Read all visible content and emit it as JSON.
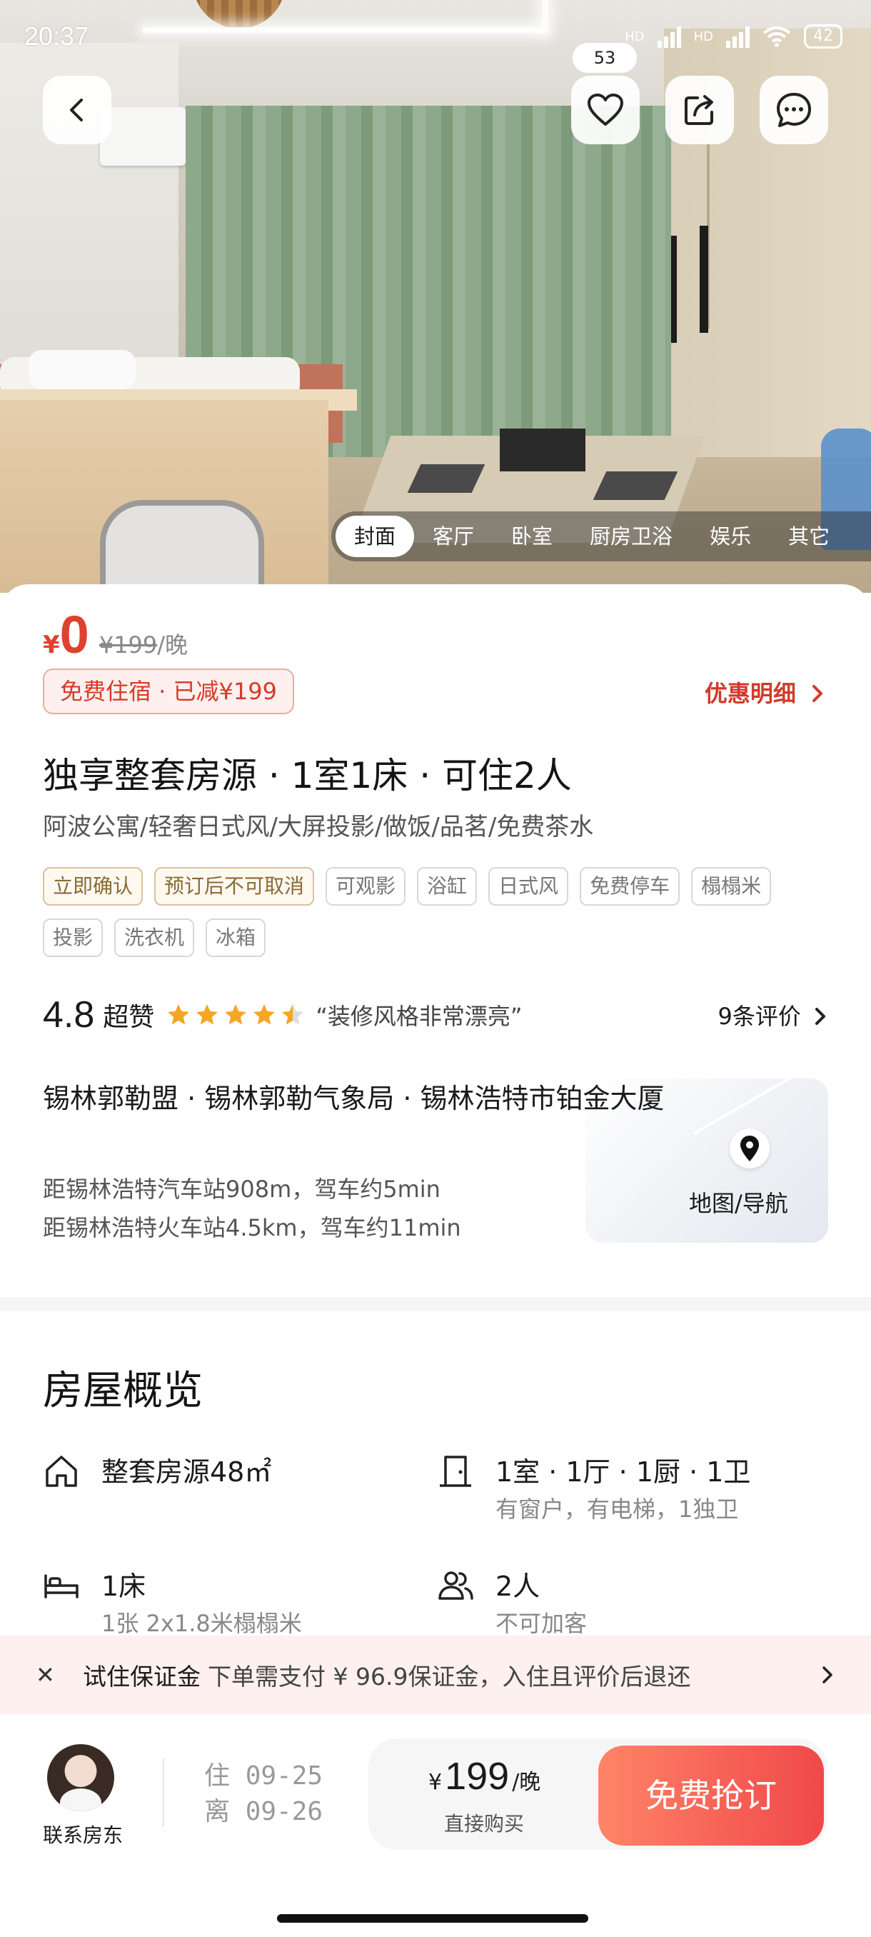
{
  "status_bar": {
    "time": "20:37",
    "network1": "HD",
    "network2": "HD",
    "battery": "42"
  },
  "top_actions": {
    "favorite_count": "53"
  },
  "photo_tabs": [
    "封面",
    "客厅",
    "卧室",
    "厨房卫浴",
    "娱乐",
    "其它"
  ],
  "price": {
    "currency": "¥",
    "current": "0",
    "original": "¥199",
    "unit": "/晚",
    "free_tag": "免费住宿 · 已减¥199",
    "discount_link": "优惠明细"
  },
  "listing": {
    "title": "独享整套房源 · 1室1床 · 可住2人",
    "subtitle": "阿波公寓/轻奢日式风/大屏投影/做饭/品茗/免费茶水",
    "tags": [
      {
        "label": "立即确认",
        "style": "warm"
      },
      {
        "label": "预订后不可取消",
        "style": "warm"
      },
      {
        "label": "可观影",
        "style": "plain"
      },
      {
        "label": "浴缸",
        "style": "plain"
      },
      {
        "label": "日式风",
        "style": "plain"
      },
      {
        "label": "免费停车",
        "style": "plain"
      },
      {
        "label": "榻榻米",
        "style": "plain"
      },
      {
        "label": "投影",
        "style": "plain"
      },
      {
        "label": "洗衣机",
        "style": "plain"
      },
      {
        "label": "冰箱",
        "style": "plain"
      }
    ]
  },
  "rating": {
    "score": "4.8",
    "praise": "超赞",
    "stars": 4.5,
    "quote": "“装修风格非常漂亮”",
    "reviews": "9条评价"
  },
  "location": {
    "address": "锡林郭勒盟 · 锡林郭勒气象局 · 锡林浩特市铂金大厦",
    "distance1": "距锡林浩特汽车站908m，驾车约5min",
    "distance2": "距锡林浩特火车站4.5km，驾车约11min",
    "map_label": "地图/导航"
  },
  "overview": {
    "title": "房屋概览",
    "items": [
      {
        "icon": "house-icon",
        "main": "整套房源48㎡",
        "sub": ""
      },
      {
        "icon": "door-icon",
        "main": "1室 · 1厅 · 1厨 · 1卫",
        "sub": "有窗户，有电梯，1独卫"
      },
      {
        "icon": "bed-icon",
        "main": "1床",
        "sub": "1张 2x1.8米榻榻米"
      },
      {
        "icon": "people-icon",
        "main": "2人",
        "sub": "不可加客"
      }
    ]
  },
  "deposit": {
    "label": "试住保证金",
    "text": "下单需支付 ¥ 96.9保证金，入住且评价后退还"
  },
  "bottom_bar": {
    "contact": "联系房东",
    "checkin_label": "住",
    "checkin": "09-25",
    "checkout_label": "离",
    "checkout": "09-26",
    "buy_currency": "¥",
    "buy_price": "199",
    "buy_unit": "/晚",
    "buy_sub": "直接购买",
    "cta": "免费抢订"
  },
  "colors": {
    "accent": "#e0402f",
    "cta_start": "#ff8467",
    "cta_end": "#f0484a",
    "star": "#f5a623"
  }
}
